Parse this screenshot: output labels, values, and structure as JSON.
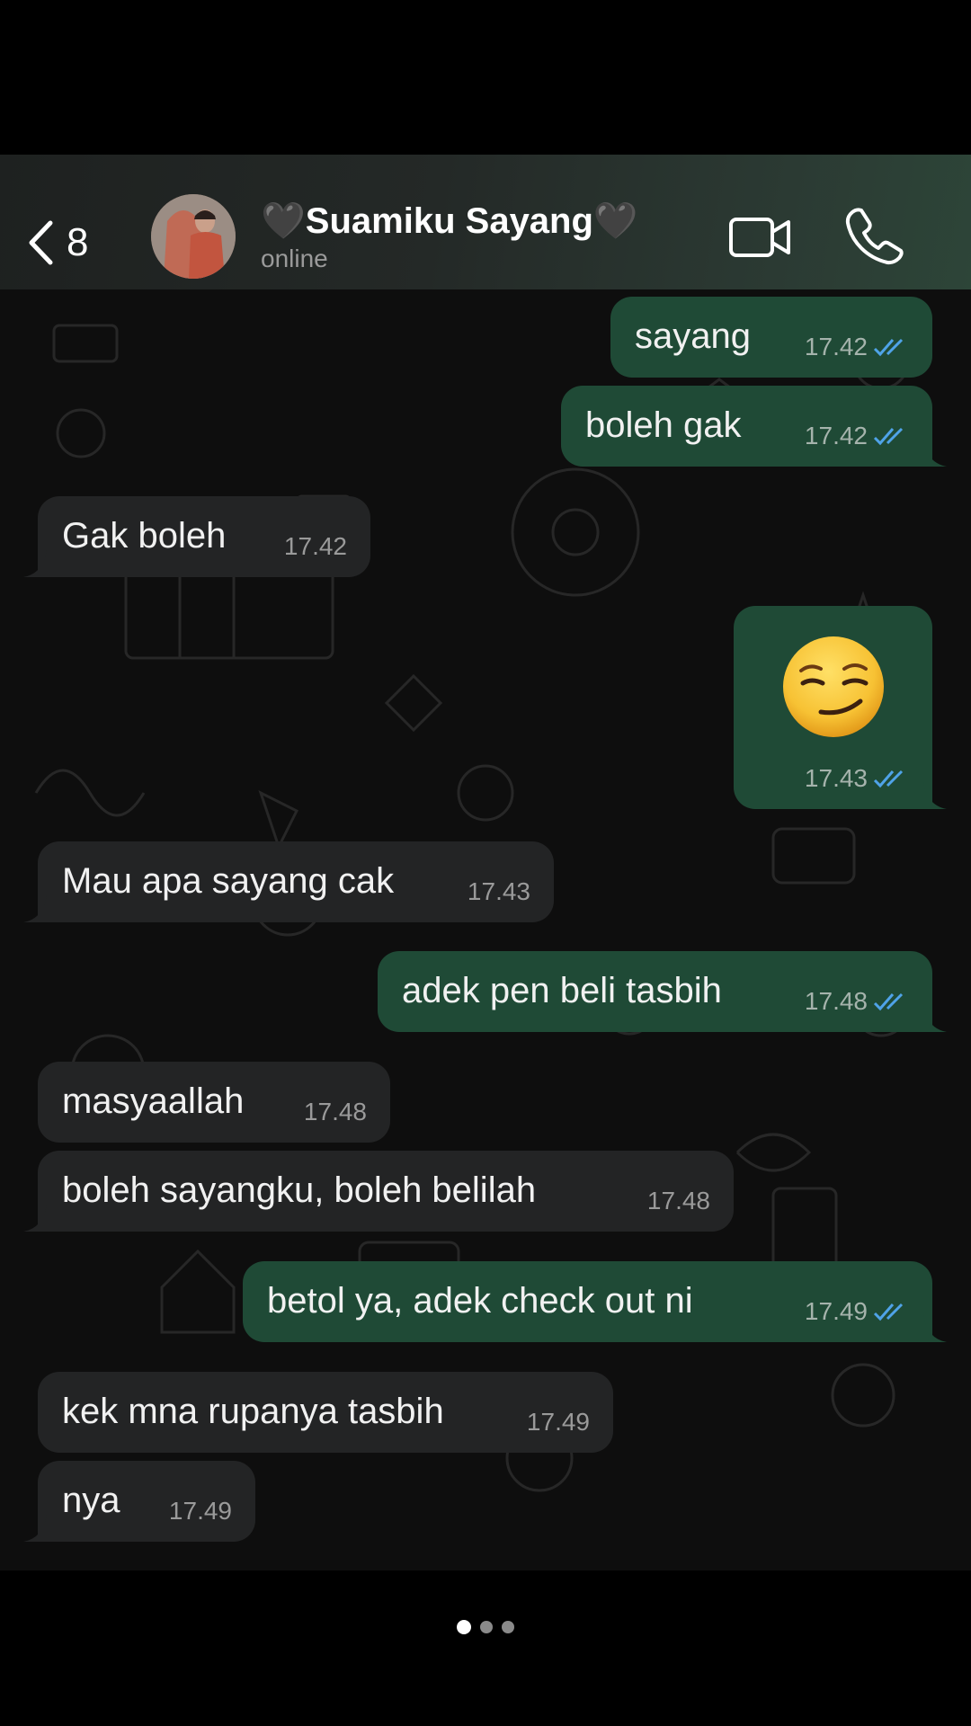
{
  "header": {
    "back_count": "8",
    "contact_name": "🖤Suamiku Sayang🖤",
    "status": "online"
  },
  "messages": [
    {
      "direction": "out",
      "text": "sayang",
      "time": "17.42",
      "read": true
    },
    {
      "direction": "out",
      "text": "boleh gak",
      "time": "17.42",
      "read": true
    },
    {
      "direction": "in",
      "text": "Gak boleh",
      "time": "17.42"
    },
    {
      "direction": "out",
      "text": "",
      "emoji": "smirking-face",
      "time": "17.43",
      "read": true
    },
    {
      "direction": "in",
      "text": "Mau apa sayang cak",
      "time": "17.43"
    },
    {
      "direction": "out",
      "text": "adek pen beli tasbih",
      "time": "17.48",
      "read": true
    },
    {
      "direction": "in",
      "text": "masyaallah",
      "time": "17.48"
    },
    {
      "direction": "in",
      "text": "boleh sayangku, boleh belilah",
      "time": "17.48"
    },
    {
      "direction": "out",
      "text": "betol ya, adek check out ni",
      "time": "17.49",
      "read": true
    },
    {
      "direction": "in",
      "text": "kek mna rupanya tasbih",
      "time": "17.49"
    },
    {
      "direction": "in",
      "text": "nya",
      "time": "17.49"
    }
  ],
  "pagination": {
    "pages": 3,
    "current": 1
  },
  "colors": {
    "outgoing_bubble": "#1f4a36",
    "incoming_bubble": "#232425",
    "read_ticks": "#4fa3e8"
  }
}
